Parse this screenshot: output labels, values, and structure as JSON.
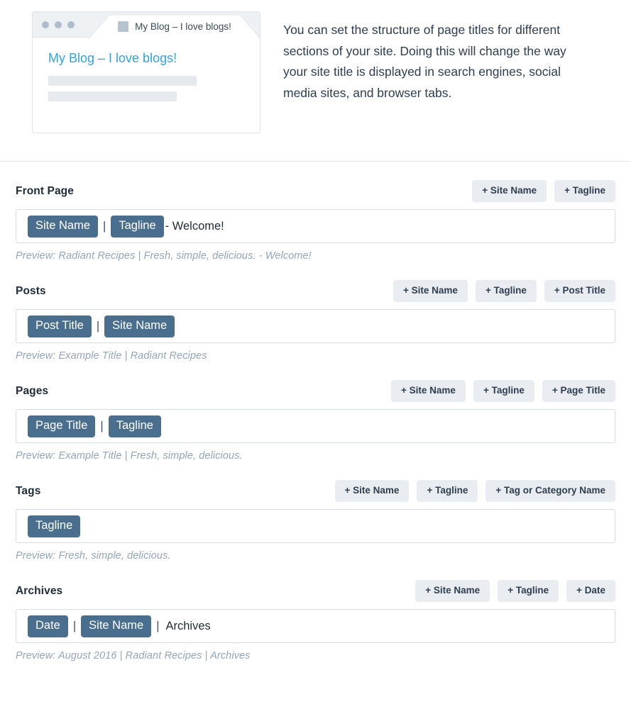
{
  "intro": {
    "browser_mockup": {
      "tab_title": "My Blog – I love blogs!",
      "page_heading": "My Blog – I love blogs!",
      "favicon": "generic-favicon",
      "dots": [
        "traffic-light-dot",
        "traffic-light-dot",
        "traffic-light-dot"
      ]
    },
    "description": "You can set the structure of page titles for different sections of your site. Doing this will change the way your site title is displayed in search engines, social media sites, and browser tabs."
  },
  "preview_prefix": "Preview:",
  "colors": {
    "token_bg": "#4a6f8e",
    "button_bg": "#e9edf1",
    "button_text": "#2e3d4f",
    "preview_text": "#93a5b6",
    "blog_title": "#2ba6e0",
    "box_border": "#d6dde4"
  },
  "sections": [
    {
      "title": "Front Page",
      "add_buttons": [
        "+ Site Name",
        "+ Tagline"
      ],
      "parts": [
        {
          "type": "token",
          "label": "Site Name"
        },
        {
          "type": "sep",
          "label": "|"
        },
        {
          "type": "token",
          "label": "Tagline"
        },
        {
          "type": "text",
          "label": "- Welcome!"
        }
      ],
      "preview": "Preview: Radiant Recipes | Fresh, simple, delicious. - Welcome!"
    },
    {
      "title": "Posts",
      "add_buttons": [
        "+ Site Name",
        "+ Tagline",
        "+ Post Title"
      ],
      "parts": [
        {
          "type": "token",
          "label": "Post Title"
        },
        {
          "type": "sep",
          "label": "|"
        },
        {
          "type": "token",
          "label": "Site Name"
        }
      ],
      "preview": "Preview: Example Title | Radiant Recipes"
    },
    {
      "title": "Pages",
      "add_buttons": [
        "+ Site Name",
        "+ Tagline",
        "+ Page Title"
      ],
      "parts": [
        {
          "type": "token",
          "label": "Page Title"
        },
        {
          "type": "sep",
          "label": "|"
        },
        {
          "type": "token",
          "label": "Tagline"
        }
      ],
      "preview": "Preview: Example Title | Fresh, simple, delicious."
    },
    {
      "title": "Tags",
      "add_buttons": [
        "+ Site Name",
        "+ Tagline",
        "+ Tag or Category Name"
      ],
      "parts": [
        {
          "type": "token",
          "label": "Tagline"
        }
      ],
      "preview": "Preview: Fresh, simple, delicious."
    },
    {
      "title": "Archives",
      "add_buttons": [
        "+ Site Name",
        "+ Tagline",
        "+ Date"
      ],
      "parts": [
        {
          "type": "token",
          "label": "Date"
        },
        {
          "type": "sep",
          "label": "|"
        },
        {
          "type": "token",
          "label": "Site Name"
        },
        {
          "type": "sep",
          "label": "|"
        },
        {
          "type": "text",
          "label": "Archives"
        }
      ],
      "preview": "Preview: August 2016 | Radiant Recipes | Archives"
    }
  ]
}
